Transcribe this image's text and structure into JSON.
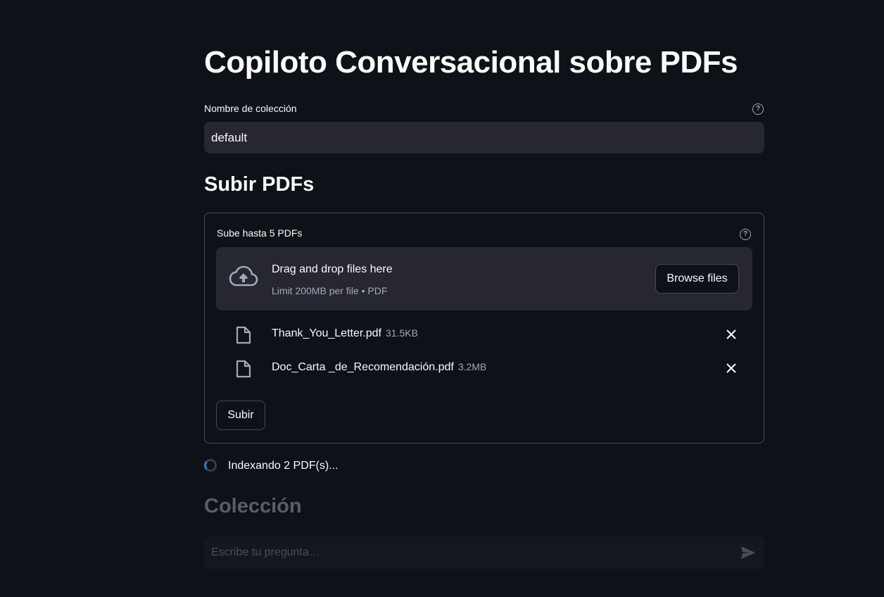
{
  "app": {
    "title": "Copiloto Conversacional sobre PDFs"
  },
  "collection_field": {
    "label": "Nombre de colección",
    "value": "default",
    "help_icon": "help-circle-icon"
  },
  "upload_section": {
    "heading": "Subir PDFs",
    "uploader_label": "Sube hasta 5 PDFs",
    "dropzone_title": "Drag and drop files here",
    "dropzone_subtitle": "Limit 200MB per file • PDF",
    "browse_label": "Browse files",
    "files": [
      {
        "name": "Thank_You_Letter.pdf",
        "size": "31.5KB"
      },
      {
        "name": "Doc_Carta _de_Recomendación.pdf",
        "size": "3.2MB"
      }
    ],
    "submit_label": "Subir"
  },
  "status": {
    "text": "Indexando 2 PDF(s)..."
  },
  "collection_section": {
    "heading": "Colección"
  },
  "chat": {
    "placeholder": "Escribe tu pregunta…",
    "send_icon": "send-icon"
  },
  "colors": {
    "background": "#0e1117",
    "input_bg": "#262730",
    "text": "#fafafa",
    "muted": "#a3a8b8",
    "spinner_accent": "#1c83e1"
  }
}
